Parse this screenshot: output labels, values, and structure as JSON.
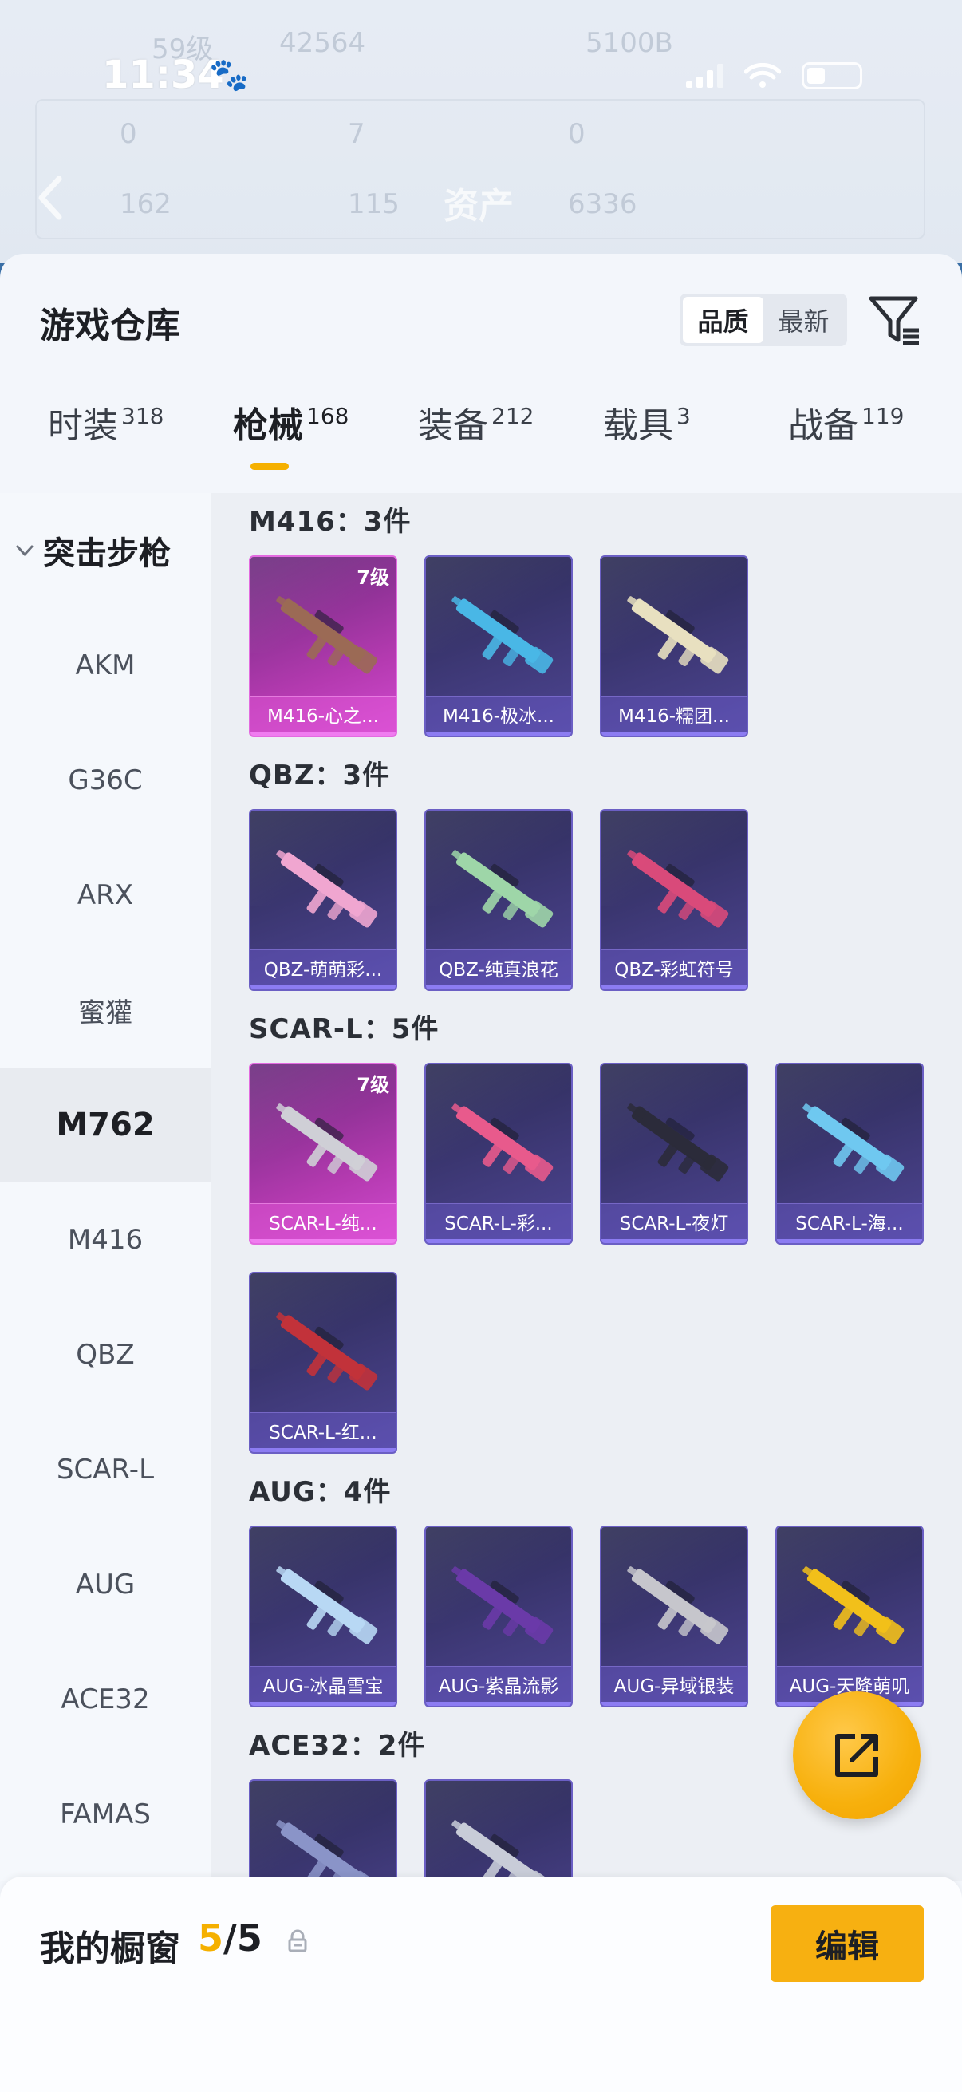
{
  "status_bar": {
    "time": "11:34"
  },
  "background": {
    "title": "资产",
    "ghost_texts": [
      "59级",
      "42564",
      "5100B",
      "0",
      "7",
      "0",
      "162",
      "115",
      "6336"
    ]
  },
  "sheet": {
    "title": "游戏仓库",
    "sort": {
      "options": [
        "品质",
        "最新"
      ],
      "active": "品质"
    }
  },
  "tabs": [
    {
      "label": "时装",
      "count": "318"
    },
    {
      "label": "枪械",
      "count": "168",
      "active": true
    },
    {
      "label": "装备",
      "count": "212"
    },
    {
      "label": "载具",
      "count": "3"
    },
    {
      "label": "战备",
      "count": "119"
    }
  ],
  "leftnav": {
    "group": "突击步枪",
    "items": [
      "AKM",
      "G36C",
      "ARX",
      "蜜獾",
      "M762",
      "M416",
      "QBZ",
      "SCAR-L",
      "AUG",
      "ACE32",
      "FAMAS"
    ],
    "active": "M762"
  },
  "groups": [
    {
      "header": "M416：3件",
      "items": [
        {
          "name": "M416-心之...",
          "level": "7级",
          "rare": true,
          "color": "#9b6a55"
        },
        {
          "name": "M416-极冰...",
          "color": "#49b7e6"
        },
        {
          "name": "M416-糯团...",
          "color": "#e8e0c0"
        }
      ]
    },
    {
      "header": "QBZ：3件",
      "items": [
        {
          "name": "QBZ-萌萌彩...",
          "color": "#f0a6d0"
        },
        {
          "name": "QBZ-纯真浪花",
          "color": "#9ed6a8"
        },
        {
          "name": "QBZ-彩虹符号",
          "color": "#d94a7a"
        }
      ]
    },
    {
      "header": "SCAR-L：5件",
      "items": [
        {
          "name": "SCAR-L-纯...",
          "level": "7级",
          "rare": true,
          "color": "#cfcfd6"
        },
        {
          "name": "SCAR-L-彩...",
          "color": "#e85a8c"
        },
        {
          "name": "SCAR-L-夜灯",
          "color": "#2b2b3a"
        },
        {
          "name": "SCAR-L-海...",
          "color": "#6fc8f0"
        },
        {
          "name": "SCAR-L-红...",
          "color": "#c2323a"
        }
      ]
    },
    {
      "header": "AUG：4件",
      "items": [
        {
          "name": "AUG-冰晶雪宝",
          "color": "#b8d8f4"
        },
        {
          "name": "AUG-紫晶流影",
          "color": "#6a3aa8"
        },
        {
          "name": "AUG-异域银装",
          "color": "#c6c6cc"
        },
        {
          "name": "AUG-天降萌叽",
          "color": "#f2c01a"
        }
      ]
    },
    {
      "header": "ACE32：2件",
      "items": [
        {
          "name": "",
          "color": "#8a94c8"
        },
        {
          "name": "",
          "color": "#c8ccd8"
        }
      ]
    }
  ],
  "bottom_bar": {
    "title": "我的橱窗",
    "count_current": "5",
    "count_sep": "/",
    "count_total": "5",
    "edit_label": "编辑"
  },
  "colors": {
    "accent": "#f5b000",
    "card_epic": "#403a7a",
    "card_legendary": "#b43ab0"
  }
}
